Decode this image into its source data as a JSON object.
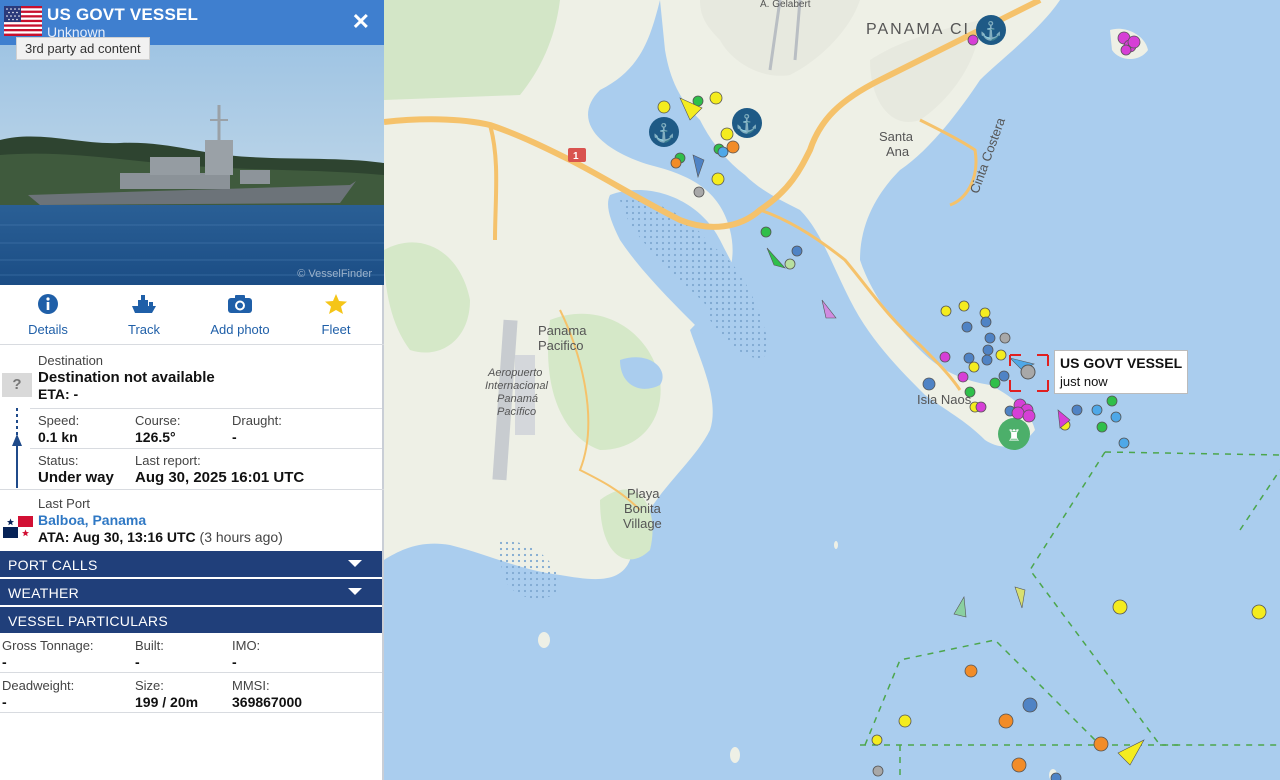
{
  "header": {
    "vessel_name": "US GOVT VESSEL",
    "vessel_type": "Unknown",
    "ad_label": "3rd party ad content",
    "watermark": "© VesselFinder"
  },
  "actions": [
    {
      "label": "Details",
      "icon": "info-icon"
    },
    {
      "label": "Track",
      "icon": "ship-icon"
    },
    {
      "label": "Add photo",
      "icon": "camera-icon"
    },
    {
      "label": "Fleet",
      "icon": "star-icon"
    }
  ],
  "destination": {
    "label": "Destination",
    "value": "Destination not available",
    "eta": "ETA: -"
  },
  "voyage": {
    "speed_label": "Speed:",
    "speed": "0.1 kn",
    "course_label": "Course:",
    "course": "126.5°",
    "draught_label": "Draught:",
    "draught": "-",
    "status_label": "Status:",
    "status": "Under way",
    "last_report_label": "Last report:",
    "last_report": "Aug 30, 2025 16:01 UTC"
  },
  "last_port": {
    "label": "Last Port",
    "port": "Balboa, Panama",
    "ata": "ATA: Aug 30, 13:16 UTC",
    "ago": "(3 hours ago)"
  },
  "sections": {
    "port_calls": "PORT CALLS",
    "weather": "WEATHER",
    "particulars": "VESSEL PARTICULARS"
  },
  "particulars": {
    "gt_label": "Gross Tonnage:",
    "gt": "-",
    "built_label": "Built:",
    "built": "-",
    "imo_label": "IMO:",
    "imo": "-",
    "dwt_label": "Deadweight:",
    "dwt": "-",
    "size_label": "Size:",
    "size": "199 / 20m",
    "mmsi_label": "MMSI:",
    "mmsi": "369867000"
  },
  "map": {
    "labels": {
      "panama_city": "PANAMA CI",
      "santa_ana_1": "Santa",
      "santa_ana_2": "Ana",
      "cinta_costera": "Cinta Costera",
      "panama_pacifico_1": "Panama",
      "panama_pacifico_2": "Pacifico",
      "airport_1": "Aeropuerto",
      "airport_2": "Internacional",
      "airport_3": "Panamá",
      "airport_4": "Pacífico",
      "isla_naos": "Isla Naos",
      "playa_1": "Playa",
      "playa_2": "Bonita",
      "playa_3": "Village",
      "gelabert": "A. Gelabert",
      "route": "1"
    },
    "tooltip_name": "US GOVT VESSEL",
    "tooltip_time": "just now"
  },
  "colors": {
    "header_blue": "#3f7fcf",
    "section_navy": "#203f7a",
    "link_blue": "#2f78c4",
    "sea": "#aacdee",
    "land": "#eef0e6"
  }
}
